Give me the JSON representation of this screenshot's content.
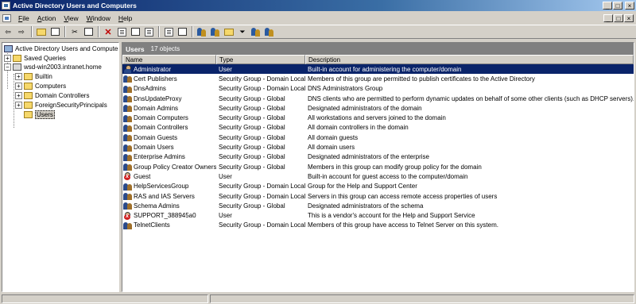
{
  "window": {
    "title": "Active Directory Users and Computers"
  },
  "menu": {
    "items": [
      {
        "label": "File",
        "ul": "F",
        "rest": "ile"
      },
      {
        "label": "Action",
        "ul": "A",
        "rest": "ction"
      },
      {
        "label": "View",
        "ul": "V",
        "rest": "iew"
      },
      {
        "label": "Window",
        "ul": "W",
        "rest": "indow"
      },
      {
        "label": "Help",
        "ul": "H",
        "rest": "elp"
      }
    ]
  },
  "tree": {
    "root": "Active Directory Users and Computer",
    "saved_queries": "Saved Queries",
    "domain": "wsd-win2003.intranet.home",
    "children": [
      "Builtin",
      "Computers",
      "Domain Controllers",
      "ForeignSecurityPrincipals",
      "Users"
    ]
  },
  "details": {
    "title": "Users",
    "count": "17 objects",
    "columns": [
      "Name",
      "Type",
      "Description"
    ],
    "rows": [
      {
        "name": "Administrator",
        "type": "User",
        "desc": "Built-in account for administering the computer/domain",
        "icon": "user-icon",
        "selected": true
      },
      {
        "name": "Cert Publishers",
        "type": "Security Group - Domain Local",
        "desc": "Members of this group are permitted to publish certificates to the Active Directory",
        "icon": "group-icon"
      },
      {
        "name": "DnsAdmins",
        "type": "Security Group - Domain Local",
        "desc": "DNS Administrators Group",
        "icon": "group-icon"
      },
      {
        "name": "DnsUpdateProxy",
        "type": "Security Group - Global",
        "desc": "DNS clients who are permitted to perform dynamic updates on behalf of some other clients (such as DHCP servers).",
        "icon": "group-icon"
      },
      {
        "name": "Domain Admins",
        "type": "Security Group - Global",
        "desc": "Designated administrators of the domain",
        "icon": "group-icon"
      },
      {
        "name": "Domain Computers",
        "type": "Security Group - Global",
        "desc": "All workstations and servers joined to the domain",
        "icon": "group-icon"
      },
      {
        "name": "Domain Controllers",
        "type": "Security Group - Global",
        "desc": "All domain controllers in the domain",
        "icon": "group-icon"
      },
      {
        "name": "Domain Guests",
        "type": "Security Group - Global",
        "desc": "All domain guests",
        "icon": "group-icon"
      },
      {
        "name": "Domain Users",
        "type": "Security Group - Global",
        "desc": "All domain users",
        "icon": "group-icon"
      },
      {
        "name": "Enterprise Admins",
        "type": "Security Group - Global",
        "desc": "Designated administrators of the enterprise",
        "icon": "group-icon"
      },
      {
        "name": "Group Policy Creator Owners",
        "type": "Security Group - Global",
        "desc": "Members in this group can modify group policy for the domain",
        "icon": "group-icon"
      },
      {
        "name": "Guest",
        "type": "User",
        "desc": "Built-in account for guest access to the computer/domain",
        "icon": "disabled-user-icon"
      },
      {
        "name": "HelpServicesGroup",
        "type": "Security Group - Domain Local",
        "desc": "Group for the Help and Support Center",
        "icon": "group-icon"
      },
      {
        "name": "RAS and IAS Servers",
        "type": "Security Group - Domain Local",
        "desc": "Servers in this group can access remote access properties of users",
        "icon": "group-icon"
      },
      {
        "name": "Schema Admins",
        "type": "Security Group - Global",
        "desc": "Designated administrators of the schema",
        "icon": "group-icon"
      },
      {
        "name": "SUPPORT_388945a0",
        "type": "User",
        "desc": "This is a vendor's account for the Help and Support Service",
        "icon": "disabled-user-icon"
      },
      {
        "name": "TelnetClients",
        "type": "Security Group - Domain Local",
        "desc": "Members of this group have access to Telnet Server on this system.",
        "icon": "group-icon"
      }
    ]
  },
  "colors": {
    "title_start": "#0a246a",
    "selection": "#0a246a",
    "header_gray": "#808080",
    "chrome": "#d4d0c8"
  }
}
